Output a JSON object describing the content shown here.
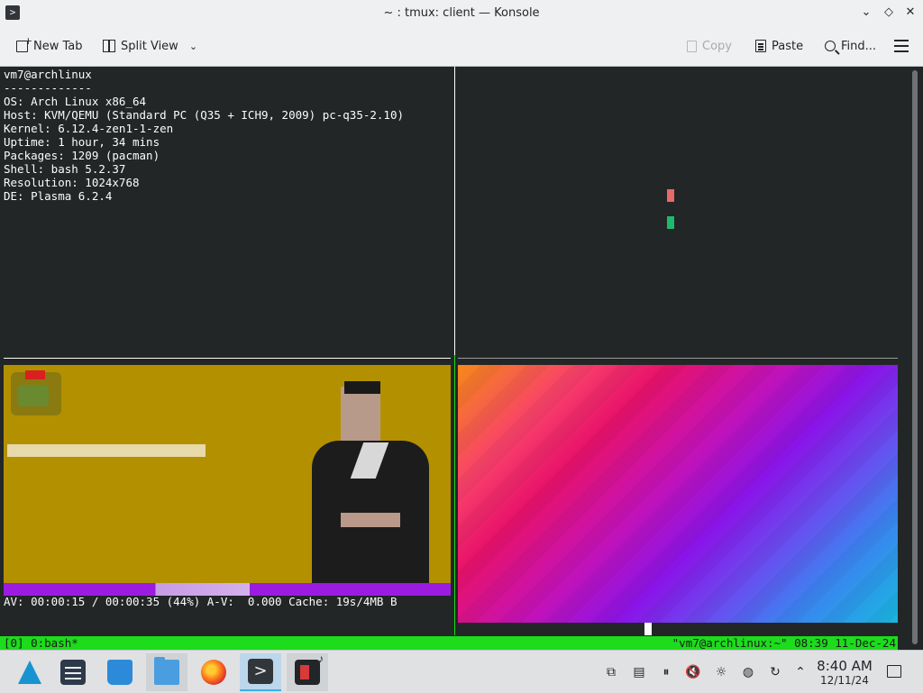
{
  "window": {
    "title": "~ : tmux: client — Konsole",
    "app_icon_glyph": ">",
    "controls": {
      "minimize": "⌄",
      "maximize": "◇",
      "close": "✕"
    }
  },
  "toolbar": {
    "new_tab": "New Tab",
    "split_view": "Split View",
    "copy": "Copy",
    "paste": "Paste",
    "find": "Find..."
  },
  "terminal": {
    "sysinfo": [
      "vm7@archlinux",
      "-------------",
      "OS: Arch Linux x86_64",
      "Host: KVM/QEMU (Standard PC (Q35 + ICH9, 2009) pc-q35-2.10)",
      "Kernel: 6.12.4-zen1-1-zen",
      "Uptime: 1 hour, 34 mins",
      "Packages: 1209 (pacman)",
      "Shell: bash 5.2.37",
      "Resolution: 1024x768",
      "DE: Plasma 6.2.4"
    ],
    "av_status": "AV: 00:00:15 / 00:00:35 (44%) A-V:  0.000 Cache: 19s/4MB B",
    "tmux_left": "[0] 0:bash*",
    "tmux_right": "\"vm7@archlinux:~\" 08:39 11-Dec-24"
  },
  "taskbar": {
    "apps": [
      "arch-launcher",
      "system-settings",
      "discover",
      "dolphin-files",
      "firefox",
      "konsole",
      "media-player"
    ],
    "konsole_glyph": ">",
    "tray": {
      "clipboard": "⧉",
      "pause": "⏸",
      "mute": "🔇",
      "brightness": "☼",
      "network": "◍",
      "update": "↻",
      "expand": "⌃"
    },
    "clock_time": "8:40 AM",
    "clock_date": "12/11/24"
  },
  "colors": {
    "terminal_bg": "#232627",
    "tmux_green": "#1cdc1c",
    "accent": "#3daee9"
  }
}
